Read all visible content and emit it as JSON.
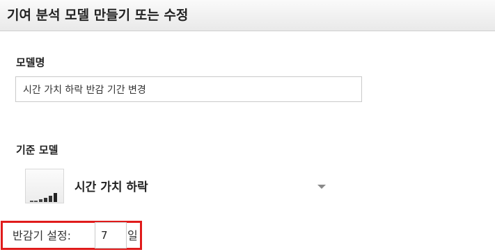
{
  "header": {
    "title": "기여 분석 모델 만들기 또는 수정"
  },
  "model_name": {
    "label": "모델명",
    "value": "시간 가치 하락 반감 기간 변경"
  },
  "base_model": {
    "label": "기준 모델",
    "selected": "시간 가치 하락",
    "icon": "ascending-bars-icon",
    "chevron_color": "#8a8a8a"
  },
  "halflife": {
    "label": "반감기 설정:",
    "value": "7",
    "unit": "일",
    "highlight_color": "#e01b1b"
  }
}
